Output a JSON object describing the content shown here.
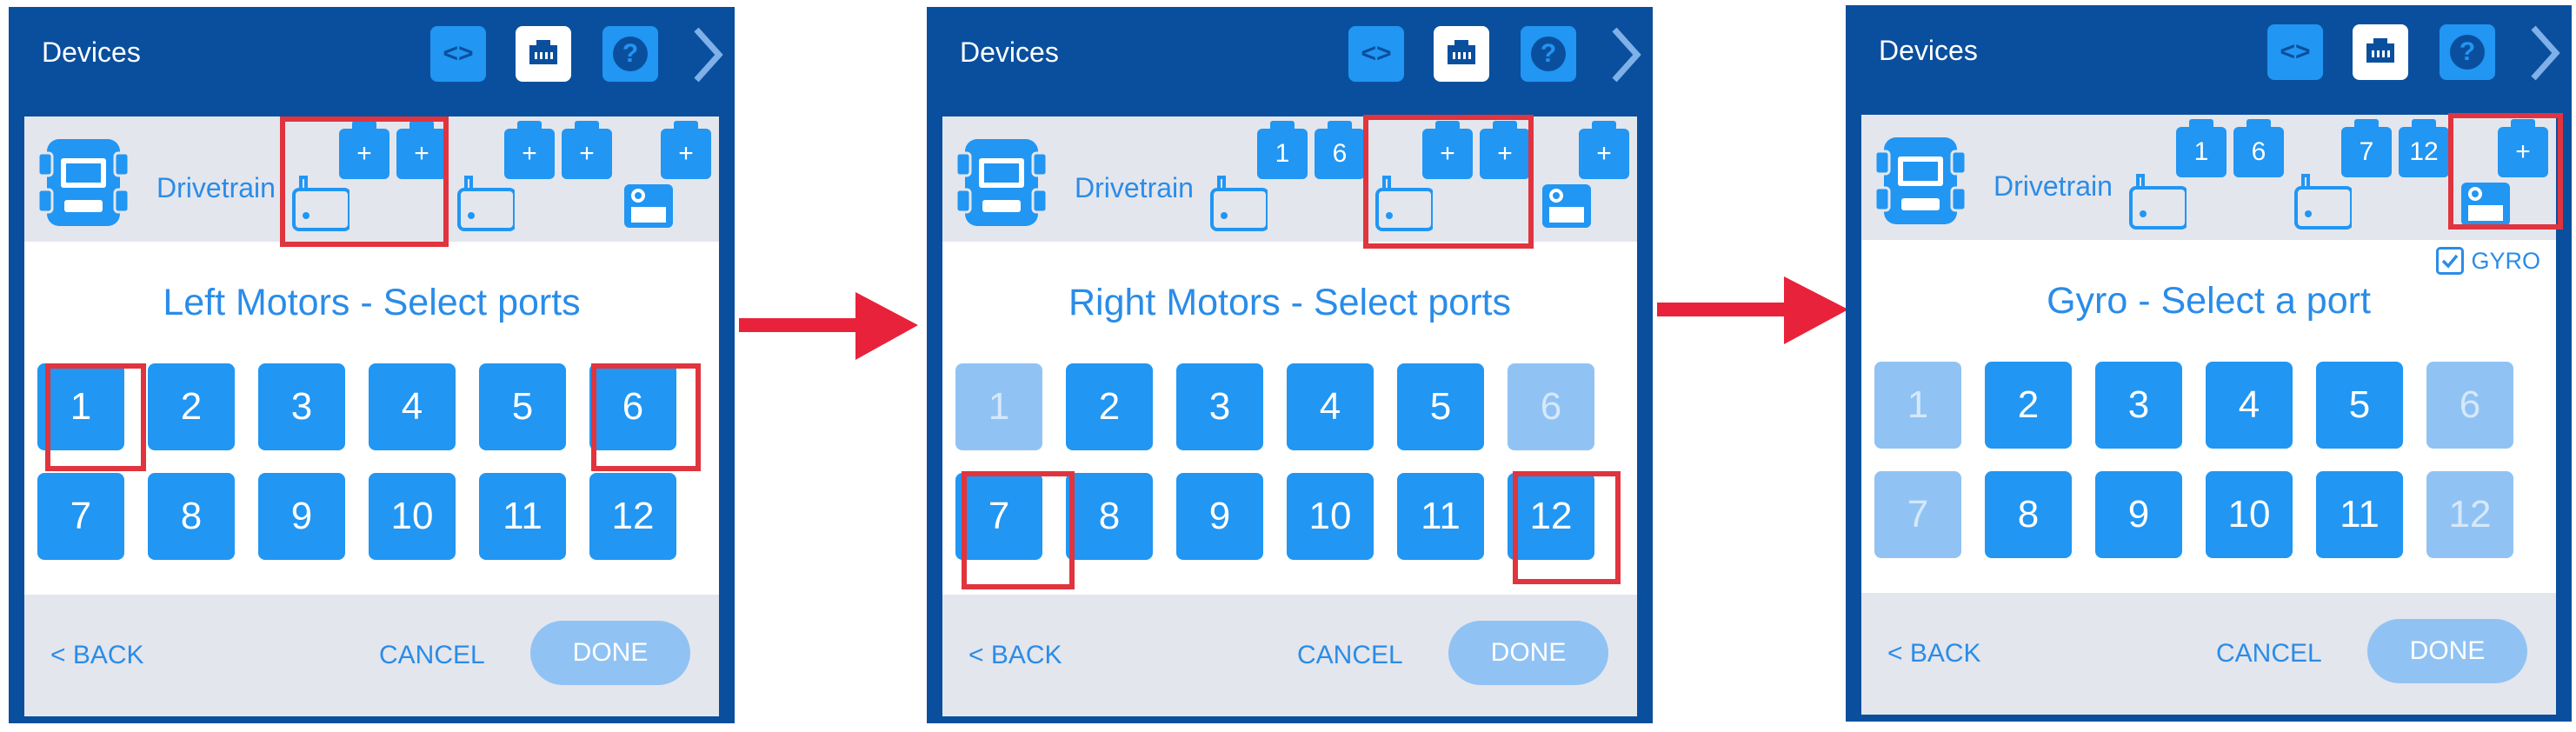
{
  "panels": [
    {
      "title": "Devices",
      "drivetrain_label": "Drivetrain",
      "left_motor_ports": [
        "+",
        "+"
      ],
      "right_motor_ports": [
        "+",
        "+"
      ],
      "gyro_port": "+",
      "heading": "Left Motors - Select ports",
      "ports": [
        {
          "label": "1",
          "enabled": true
        },
        {
          "label": "2",
          "enabled": true
        },
        {
          "label": "3",
          "enabled": true
        },
        {
          "label": "4",
          "enabled": true
        },
        {
          "label": "5",
          "enabled": true
        },
        {
          "label": "6",
          "enabled": true
        },
        {
          "label": "7",
          "enabled": true
        },
        {
          "label": "8",
          "enabled": true
        },
        {
          "label": "9",
          "enabled": true
        },
        {
          "label": "10",
          "enabled": true
        },
        {
          "label": "11",
          "enabled": true
        },
        {
          "label": "12",
          "enabled": true
        }
      ],
      "back_label": "< BACK",
      "cancel_label": "CANCEL",
      "done_label": "DONE"
    },
    {
      "title": "Devices",
      "drivetrain_label": "Drivetrain",
      "left_motor_ports": [
        "1",
        "6"
      ],
      "right_motor_ports": [
        "+",
        "+"
      ],
      "gyro_port": "+",
      "heading": "Right Motors - Select ports",
      "ports": [
        {
          "label": "1",
          "enabled": false
        },
        {
          "label": "2",
          "enabled": true
        },
        {
          "label": "3",
          "enabled": true
        },
        {
          "label": "4",
          "enabled": true
        },
        {
          "label": "5",
          "enabled": true
        },
        {
          "label": "6",
          "enabled": false
        },
        {
          "label": "7",
          "enabled": true
        },
        {
          "label": "8",
          "enabled": true
        },
        {
          "label": "9",
          "enabled": true
        },
        {
          "label": "10",
          "enabled": true
        },
        {
          "label": "11",
          "enabled": true
        },
        {
          "label": "12",
          "enabled": true
        }
      ],
      "back_label": "< BACK",
      "cancel_label": "CANCEL",
      "done_label": "DONE"
    },
    {
      "title": "Devices",
      "drivetrain_label": "Drivetrain",
      "left_motor_ports": [
        "1",
        "6"
      ],
      "right_motor_ports": [
        "7",
        "12"
      ],
      "gyro_port": "+",
      "checkbox_label": "GYRO",
      "checkbox_checked": true,
      "heading": "Gyro - Select a port",
      "ports": [
        {
          "label": "1",
          "enabled": false
        },
        {
          "label": "2",
          "enabled": true
        },
        {
          "label": "3",
          "enabled": true
        },
        {
          "label": "4",
          "enabled": true
        },
        {
          "label": "5",
          "enabled": true
        },
        {
          "label": "6",
          "enabled": false
        },
        {
          "label": "7",
          "enabled": false
        },
        {
          "label": "8",
          "enabled": true
        },
        {
          "label": "9",
          "enabled": true
        },
        {
          "label": "10",
          "enabled": true
        },
        {
          "label": "11",
          "enabled": true
        },
        {
          "label": "12",
          "enabled": false
        }
      ],
      "back_label": "< BACK",
      "cancel_label": "CANCEL",
      "done_label": "DONE"
    }
  ],
  "colors": {
    "header_blue": "#0a4f9e",
    "button_blue": "#2196f3",
    "disabled_blue": "#90c3f3",
    "text_blue": "#2a8ce8",
    "strip_gray": "#e4e6ed",
    "highlight_red": "#e0343e"
  },
  "icons": [
    "code-icon",
    "port-icon",
    "help-icon",
    "chevron-right-icon",
    "drivetrain-icon",
    "motor-icon",
    "gyro-icon",
    "check-icon",
    "arrow-right-icon"
  ]
}
